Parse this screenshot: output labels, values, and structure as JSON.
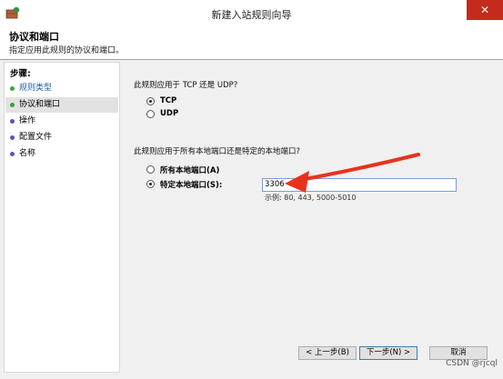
{
  "window": {
    "title": "新建入站规则向导",
    "close_glyph": "✕"
  },
  "header": {
    "title": "协议和端口",
    "subtitle": "指定应用此规则的协议和端口。"
  },
  "steps": {
    "title": "步骤:",
    "items": [
      {
        "label": "规则类型"
      },
      {
        "label": "协议和端口"
      },
      {
        "label": "操作"
      },
      {
        "label": "配置文件"
      },
      {
        "label": "名称"
      }
    ]
  },
  "protocol": {
    "question": "此规则应用于 TCP 还是 UDP?",
    "options": [
      {
        "label": "TCP",
        "selected": true
      },
      {
        "label": "UDP",
        "selected": false
      }
    ]
  },
  "ports": {
    "question": "此规则应用于所有本地端口还是特定的本地端口?",
    "options": [
      {
        "label": "所有本地端口(A)",
        "selected": false
      },
      {
        "label": "特定本地端口(S):",
        "selected": true
      }
    ],
    "value": "3306",
    "example": "示例: 80, 443, 5000-5010"
  },
  "buttons": {
    "back": "< 上一步(B)",
    "next": "下一步(N) >",
    "cancel": "取消"
  },
  "watermark": "CSDN @rjcql",
  "colors": {
    "arrow": "#e8321e",
    "close": "#c42b1c",
    "step_done": "#3aa33a",
    "step_pending": "#5e4fc6"
  }
}
